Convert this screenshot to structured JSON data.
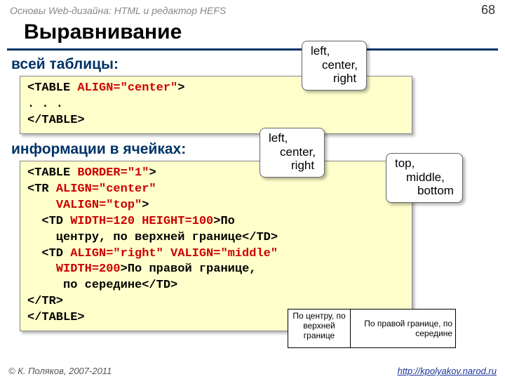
{
  "header": {
    "course_title": "Основы Web-дизайна: HTML и редактор HEFS",
    "page_number": "68"
  },
  "title": "Выравнивание",
  "section1": {
    "heading": "всей таблицы:",
    "code_line1a": "<TABLE ",
    "code_line1b": "ALIGN=\"center\"",
    "code_line1c": ">",
    "code_line2": ". . .",
    "code_line3": "</TABLE>"
  },
  "section2": {
    "heading": "информации в ячейках:",
    "code_l1a": "<TABLE ",
    "code_l1b": "BORDER=\"1\"",
    "code_l1c": ">",
    "code_l2a": "<TR ",
    "code_l2b": "ALIGN=\"center\"",
    "code_l3a": "    ",
    "code_l3b": "VALIGN=\"top\"",
    "code_l3c": ">",
    "code_l4a": "  <TD ",
    "code_l4b": "WIDTH=120 HEIGHT=100",
    "code_l4c": ">По",
    "code_l5": "    центру, по верхней границе</TD>",
    "code_l6a": "  <TD ",
    "code_l6b": "ALIGN=\"right\" VALIGN=\"middle\"",
    "code_l7a": "    ",
    "code_l7b": "WIDTH=200",
    "code_l7c": ">По правой границе,",
    "code_l8": "     по середине</TD>",
    "code_l9": "</TR>",
    "code_l10": "</TABLE>"
  },
  "callout_align": {
    "l1": "left,",
    "l2": "center,",
    "l3": "right"
  },
  "callout_valign": {
    "l1": "top,",
    "l2": "middle,",
    "l3": "bottom"
  },
  "preview": {
    "cell1": "По центру, по верхней границе",
    "cell2": "По правой границе, по середине"
  },
  "footer": {
    "copyright": "© К. Поляков, 2007-2011",
    "url": "http://kpolyakov.narod.ru"
  }
}
